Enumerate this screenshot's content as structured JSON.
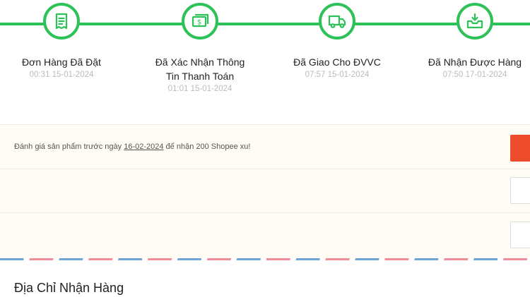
{
  "steps": [
    {
      "label_line1": "Đơn Hàng Đã Đặt",
      "label_line2": "",
      "time": "00:31 15-01-2024",
      "icon": "receipt-icon"
    },
    {
      "label_line1": "Đã Xác Nhận Thông",
      "label_line2": "Tin Thanh Toán",
      "time": "01:01 15-01-2024",
      "icon": "money-icon"
    },
    {
      "label_line1": "Đã Giao Cho ĐVVC",
      "label_line2": "",
      "time": "07:57 15-01-2024",
      "icon": "truck-icon"
    },
    {
      "label_line1": "Đã Nhận Được Hàng",
      "label_line2": "",
      "time": "07:50 17-01-2024",
      "icon": "inbox-download-icon"
    }
  ],
  "review": {
    "prefix": "Đánh giá sản phẩm trước ngày ",
    "date": "16-02-2024",
    "suffix": " để nhận 200 Shopee xu!"
  },
  "address": {
    "title": "Địa Chỉ Nhận Hàng"
  },
  "colors": {
    "accent_green": "#2dc258",
    "shopee_orange": "#ee4d2d",
    "panel_bg": "#fffcf5"
  }
}
